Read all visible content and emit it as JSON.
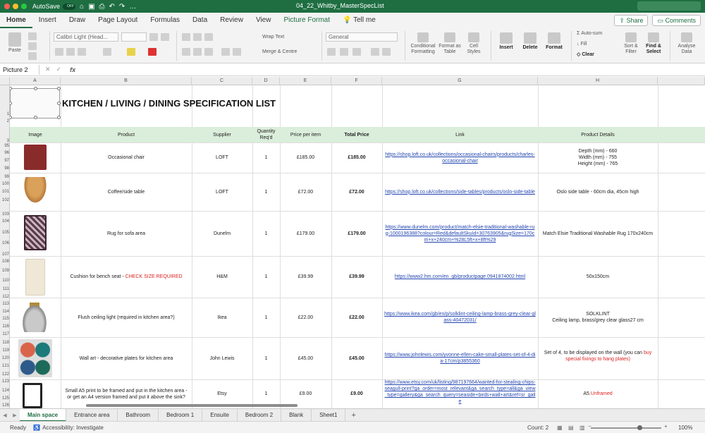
{
  "title_bar": {
    "autosave_label": "AutoSave",
    "autosave_state": "OFF",
    "document_title": "04_22_Whitby_MasterSpecList"
  },
  "menu": {
    "tabs": [
      "Home",
      "Insert",
      "Draw",
      "Page Layout",
      "Formulas",
      "Data",
      "Review",
      "View",
      "Picture Format",
      "Tell me"
    ],
    "share_label": "Share",
    "comments_label": "Comments"
  },
  "ribbon": {
    "paste": "Paste",
    "font_name": "Calibri Light (Head...",
    "wrap_text": "Wrap Text",
    "merge_centre": "Merge & Centre",
    "number_format": "General",
    "conditional_formatting": "Conditional Formatting",
    "format_as_table": "Format as Table",
    "cell_styles": "Cell Styles",
    "insert": "Insert",
    "delete": "Delete",
    "format": "Format",
    "auto_sum": "Auto-sum",
    "fill": "Fill",
    "clear": "Clear",
    "sort_filter": "Sort & Filter",
    "find_select": "Find & Select",
    "analyse_data": "Analyse Data"
  },
  "formula_bar": {
    "name_box": "Picture 2",
    "fx": "fx"
  },
  "columns": [
    "A",
    "B",
    "C",
    "D",
    "E",
    "F",
    "G",
    "H"
  ],
  "sheet": {
    "title": "KITCHEN / LIVING / DINING SPECIFICATION LIST",
    "headers": [
      "Image",
      "Product",
      "Supplier",
      "Quantity Req'd",
      "Price per item",
      "Total Price",
      "Link",
      "Product Details"
    ],
    "rows": [
      {
        "product": "Occasional chair",
        "product_note": "",
        "supplier": "LOFT",
        "qty": "1",
        "price": "£185.00",
        "total": "£185.00",
        "link": "https://shop.loft.co.uk/collections/occasional-chairs/products/charles-occasional-chair",
        "details": "Depth (mm) - 660\nWidth (mm) - 755\nHeight (mm) - 765",
        "details_red": ""
      },
      {
        "product": "Coffee/side table",
        "product_note": "",
        "supplier": "LOFT",
        "qty": "1",
        "price": "£72.00",
        "total": "£72.00",
        "link": "https://shop.loft.co.uk/collections/side-tables/products/oslo-side-table",
        "details": "Oslo side table - 60cm dia, 45cm high",
        "details_red": ""
      },
      {
        "product": "Rug for sofa area",
        "product_note": "",
        "supplier": "Dunelm",
        "qty": "1",
        "price": "£179.00",
        "total": "£179.00",
        "link": "https://www.dunelm.com/product/match-elsie-traditional-washable-rug-1000196388?colour=Red&defaultSkuId=30763905&rugSize=170cm+x+240cm+%28L5ft+x+8ft%29",
        "details": "Match Elsie Traditional Washable Rug 170x240cm",
        "details_red": ""
      },
      {
        "product": "Cushion for bench seat - ",
        "product_note": "CHECK SIZE REQUIRED",
        "supplier": "H&M",
        "qty": "1",
        "price": "£39.99",
        "total": "£39.99",
        "link": "https://www2.hm.com/en_gb/productpage.0941874002.html",
        "details": "50x150cm",
        "details_red": ""
      },
      {
        "product": "Flush ceiling light (required in kitchen area?)",
        "product_note": "",
        "supplier": "Ikea",
        "qty": "1",
        "price": "£22.00",
        "total": "£22.00",
        "link": "https://www.ikea.com/gb/en/p/solklint-ceiling-lamp-brass-grey-clear-glass-40472031/",
        "details": "SOLKLINT\nCeiling lamp, brass/grey clear glass27 cm",
        "details_red": ""
      },
      {
        "product": "Wall art - decorative plates for kitchen area",
        "product_note": "",
        "supplier": "John Lewis",
        "qty": "1",
        "price": "£45.00",
        "total": "£45.00",
        "link": "https://www.johnlewis.com/yvonne-ellen-cake-small-plates-set-of-4-dia-17cm/p3855360",
        "details": "Set of 4, to be displayed on the wall (you can ",
        "details_red": "buy special fixings to hang plates)"
      },
      {
        "product": "Small A5 print to be framed and put in the kitchen area - or get an A4 version framed and put it above the sink?",
        "product_note": "",
        "supplier": "Etsy",
        "qty": "1",
        "price": "£9.00",
        "total": "£9.00",
        "link": "https://www.etsy.com/uk/listing/987197664/wanted-for-stealing-chips-seagull-print?ga_order=most_relevant&ga_search_type=all&ga_view_type=gallery&ga_search_query=seaside+birds+wall+art&ref=sr_galle",
        "details": "A5. ",
        "details_red": "Unframed"
      }
    ]
  },
  "row_numbers": [
    "1",
    "2",
    "3",
    "95",
    "96",
    "97",
    "98",
    "99",
    "100",
    "101",
    "102",
    "103",
    "104",
    "105",
    "106",
    "107",
    "108",
    "109",
    "110",
    "111",
    "112",
    "113",
    "114",
    "115",
    "116",
    "117",
    "118",
    "119",
    "120",
    "121",
    "122",
    "123",
    "124",
    "125",
    "126"
  ],
  "sheet_tabs": [
    "Main space",
    "Entrance area",
    "Bathroom",
    "Bedroom 1",
    "Ensuite",
    "Bedroom 2",
    "Blank",
    "Sheet1"
  ],
  "status": {
    "ready": "Ready",
    "accessibility": "Accessibility: Investigate",
    "count": "Count: 2",
    "zoom": "100%"
  },
  "colors": {
    "accent": "#1e6e42",
    "header_fill": "#dbeedb",
    "link": "#2346b0",
    "warning": "#d22222"
  }
}
